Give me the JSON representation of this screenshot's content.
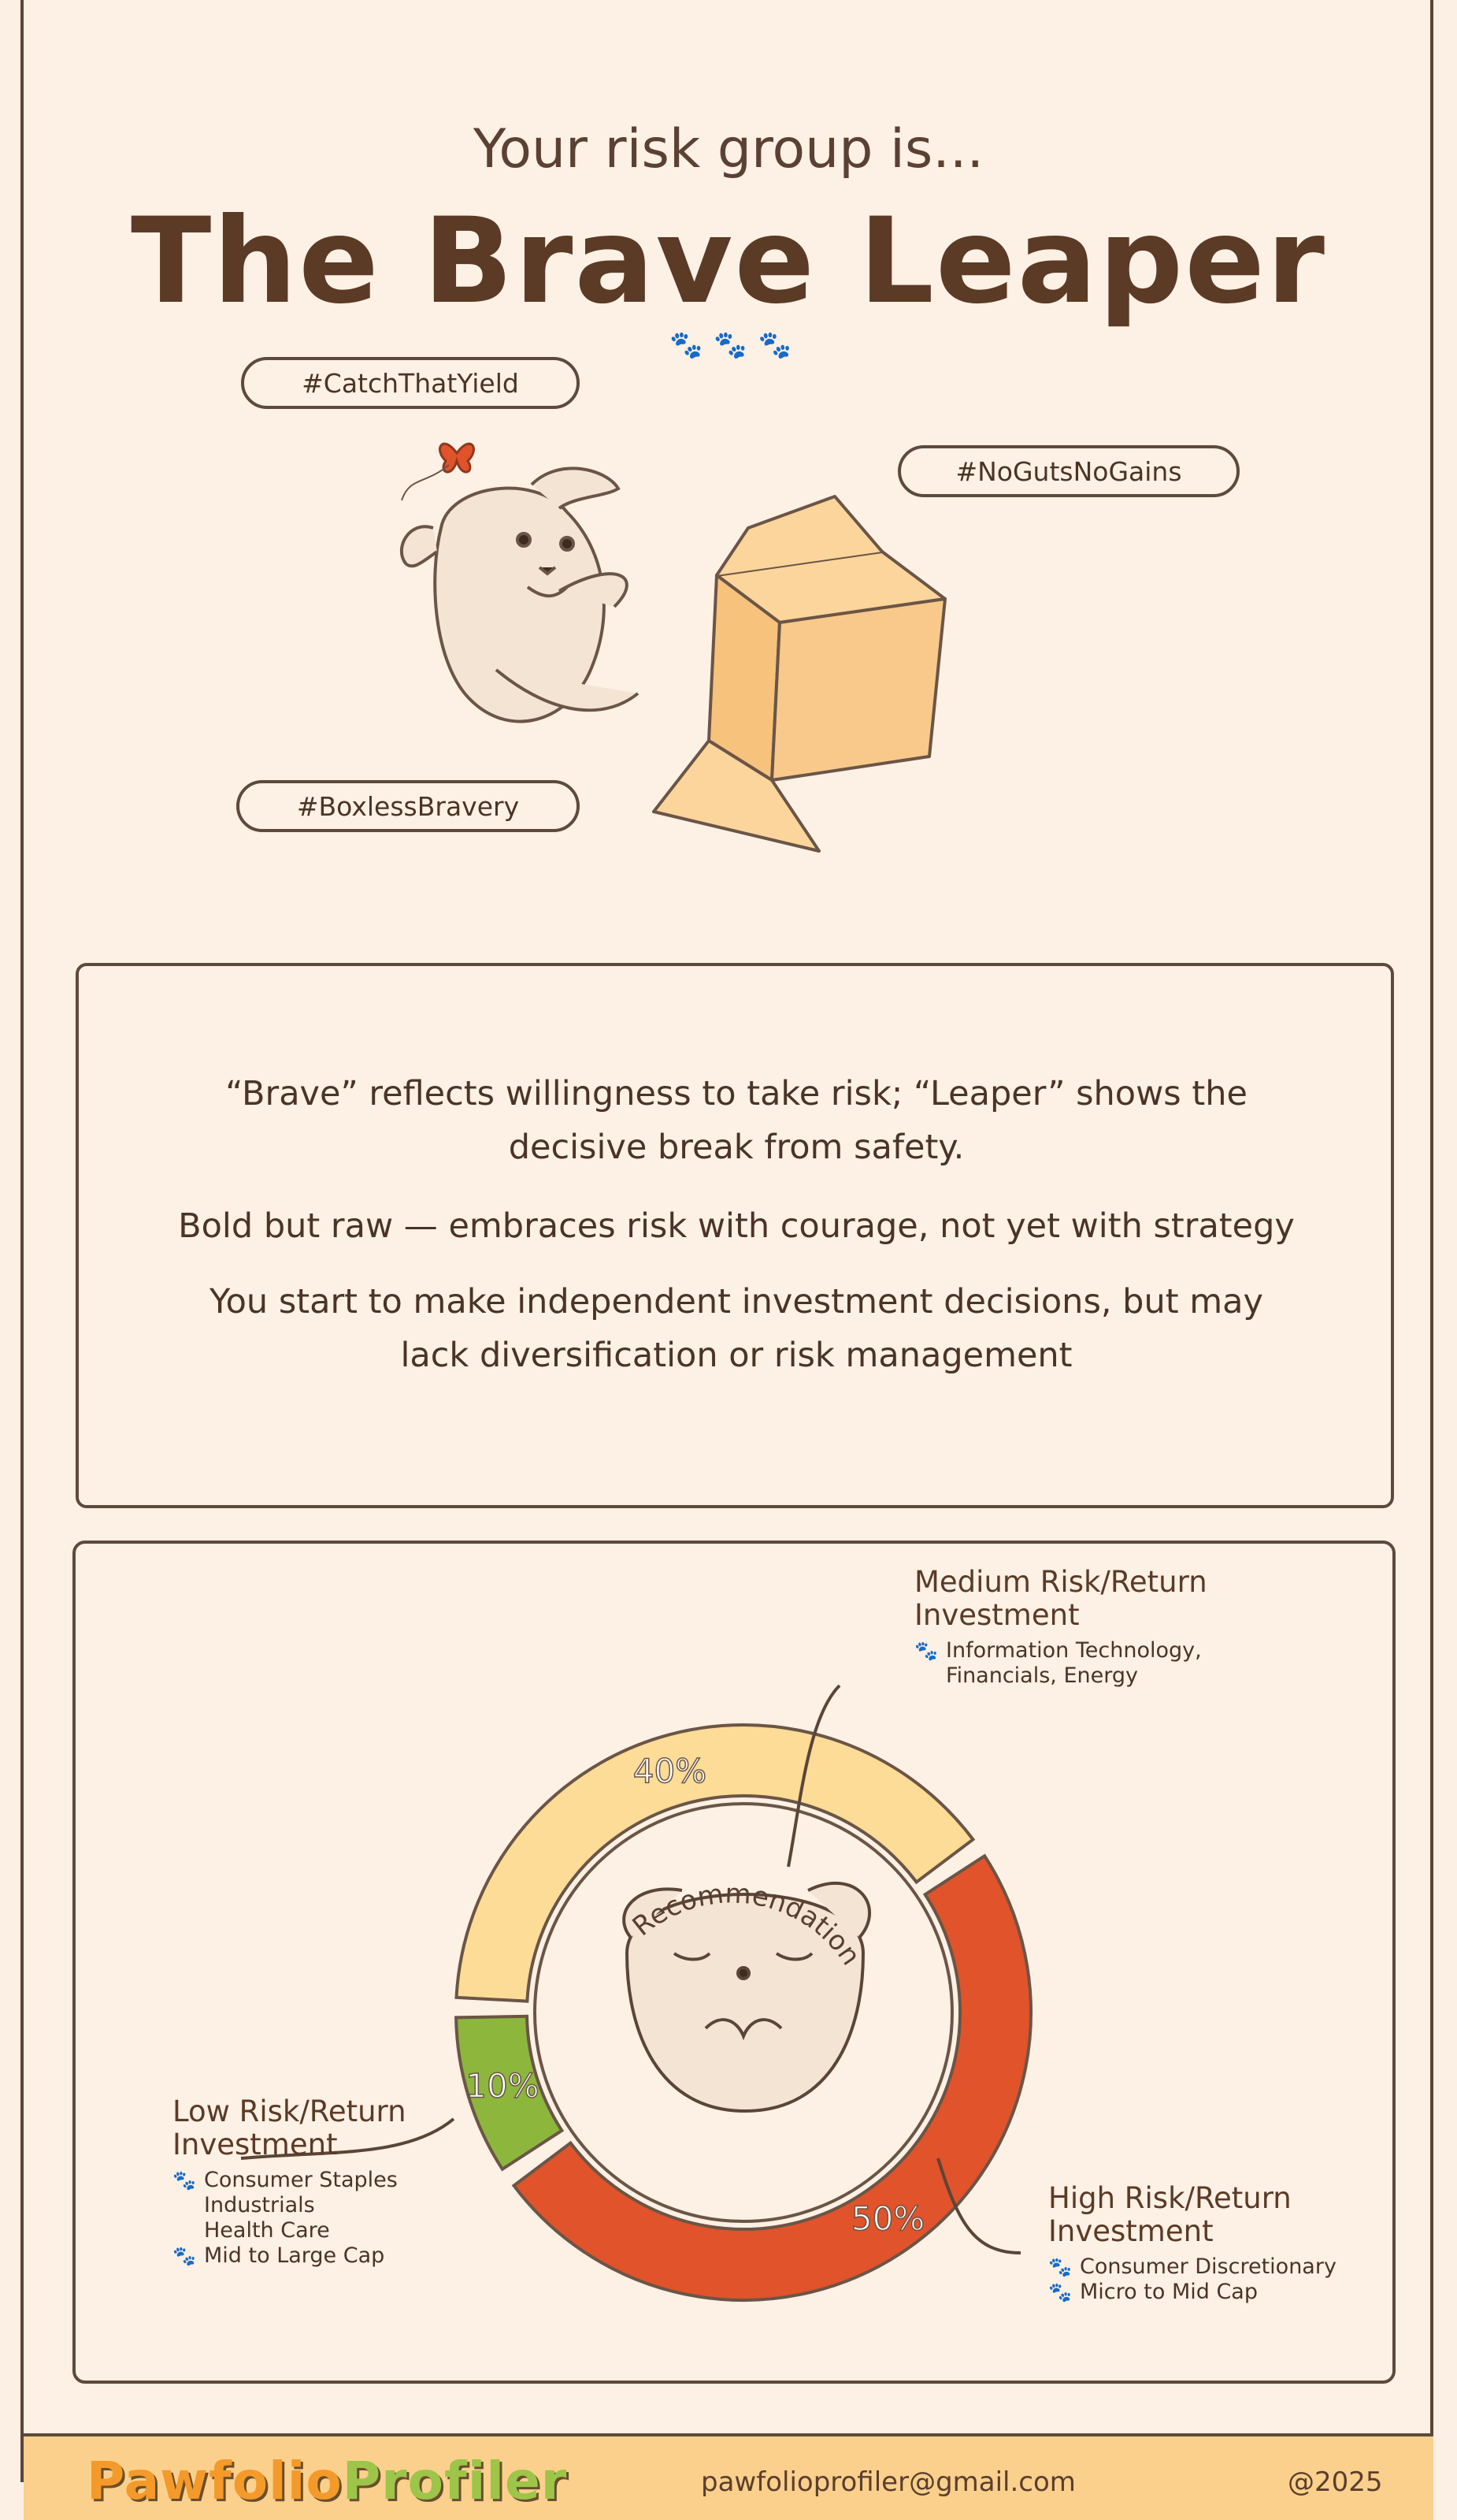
{
  "header": {
    "intro": "Your risk group is...",
    "title": "The Brave Leaper"
  },
  "tags": [
    "#CatchThatYield",
    "#NoGutsNoGains",
    "#BoxlessBravery"
  ],
  "description": {
    "p1": "“Brave” reflects willingness to take risk; “Leaper” shows the decisive break from safety.",
    "p2": "Bold but raw — embraces risk with courage, not yet with strategy",
    "p3": "You start to make independent investment decisions, but may lack diversification or risk management"
  },
  "chart_data": {
    "type": "donut",
    "center_label": "Recommendation",
    "segments": [
      {
        "name": "Low Risk/Return Investment",
        "value": 10,
        "label": "10%",
        "color": "#8cb63c",
        "items": [
          "Consumer Staples",
          "Industrials",
          "Health Care",
          "Mid to Large Cap"
        ]
      },
      {
        "name": "Medium Risk/Return Investment",
        "value": 40,
        "label": "40%",
        "color": "#fcdc96",
        "items": [
          "Information Technology, Financials, Energy"
        ]
      },
      {
        "name": "High Risk/Return Investment",
        "value": 50,
        "label": "50%",
        "color": "#e0532b",
        "items": [
          "Consumer Discretionary",
          "Micro to Mid Cap"
        ]
      }
    ]
  },
  "recommendation": {
    "medium": {
      "title_l1": "Medium Risk/Return",
      "title_l2": "Investment",
      "item1_l1": "Information Technology,",
      "item1_l2": "Financials, Energy"
    },
    "low": {
      "title_l1": "Low Risk/Return",
      "title_l2": "Investment",
      "item1": "Consumer Staples",
      "item2": "Industrials",
      "item3": "Health Care",
      "item4": "Mid to Large Cap"
    },
    "high": {
      "title_l1": "High Risk/Return",
      "title_l2": "Investment",
      "item1": "Consumer Discretionary",
      "item2": "Micro to Mid Cap"
    }
  },
  "footer": {
    "brand_part1": "Pawfolio",
    "brand_part2": "Profiler",
    "email": "pawfolioprofiler@gmail.com",
    "copyright": "@2025"
  }
}
